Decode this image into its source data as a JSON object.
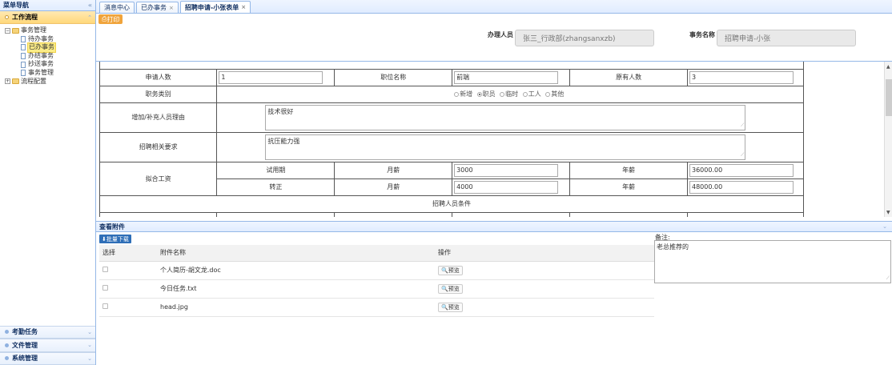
{
  "sidebar": {
    "title": "菜单导航",
    "collapse_icon": "«",
    "workflow": {
      "title": "工作流程",
      "tree": {
        "root": "事务管理",
        "children": [
          "待办事务",
          "已办事务",
          "办结事务",
          "抄送事务",
          "事务管理"
        ],
        "config": "流程配置"
      }
    },
    "bottom": [
      "考勤任务",
      "文件管理",
      "系统管理"
    ]
  },
  "tabs": [
    {
      "label": "消息中心",
      "closable": false
    },
    {
      "label": "已办事务",
      "closable": true
    },
    {
      "label": "招聘申请-小张表单",
      "closable": true
    }
  ],
  "top": {
    "print": "打印",
    "handler_label": "办理人员",
    "handler_value": "张三_行政部(zhangsanxzb)",
    "affair_label": "事务名称",
    "affair_value": "招聘申请-小张"
  },
  "form": {
    "applicant_count_label": "申请人数",
    "applicant_count": "1",
    "position_label": "职位名称",
    "position": "前端",
    "original_count_label": "原有人数",
    "original_count": "3",
    "job_type_label": "职务类别",
    "job_types": [
      "新增",
      "职员",
      "临时",
      "工人",
      "其他"
    ],
    "job_type_selected": "职员",
    "reason_label": "增加/补充人员理由",
    "reason": "技术很好",
    "requirement_label": "招聘相关要求",
    "requirement": "抗压能力强",
    "salary_label": "拟合工资",
    "probation": "试用期",
    "regular": "转正",
    "month_label": "月薪",
    "year_label": "年薪",
    "probation_month": "3000",
    "probation_year": "36000.00",
    "regular_month": "4000",
    "regular_year": "48000.00",
    "condition_label": "招聘人员条件"
  },
  "attachments": {
    "title": "查看附件",
    "batch_download": "批量下载",
    "columns": [
      "选择",
      "附件名称",
      "操作"
    ],
    "files": [
      "个人简历-胡文龙.doc",
      "今日任务.txt",
      "head.jpg"
    ],
    "preview": "预览"
  },
  "remark": {
    "label": "备注:",
    "value": "老总推荐的"
  }
}
